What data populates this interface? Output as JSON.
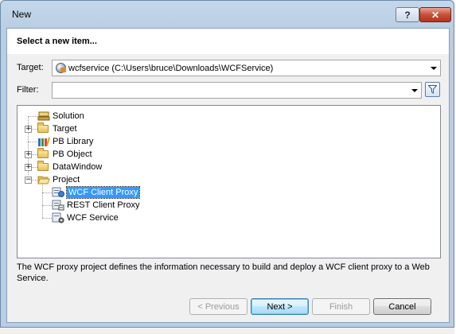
{
  "window": {
    "title": "New"
  },
  "title_buttons": {
    "help": "?",
    "close": "✕"
  },
  "header": {
    "heading": "Select a new item..."
  },
  "target": {
    "label": "Target:",
    "value": "wcfservice (C:\\Users\\bruce\\Downloads\\WCFService)"
  },
  "filter": {
    "label": "Filter:",
    "value": ""
  },
  "tree": {
    "items": [
      {
        "label": "Solution"
      },
      {
        "label": "Target"
      },
      {
        "label": "PB Library"
      },
      {
        "label": "PB Object"
      },
      {
        "label": "DataWindow"
      },
      {
        "label": "Project"
      },
      {
        "label": "WCF Client Proxy"
      },
      {
        "label": "REST Client Proxy"
      },
      {
        "label": "WCF Service"
      }
    ]
  },
  "description": "The WCF proxy project defines the information necessary to build and deploy a WCF client proxy to a Web Service.",
  "buttons": {
    "previous": "< Previous",
    "next": "Next >",
    "finish": "Finish",
    "cancel": "Cancel"
  },
  "colors": {
    "selection": "#3399ff",
    "title_bar": "#b9cde3",
    "close_button": "#c75039"
  }
}
